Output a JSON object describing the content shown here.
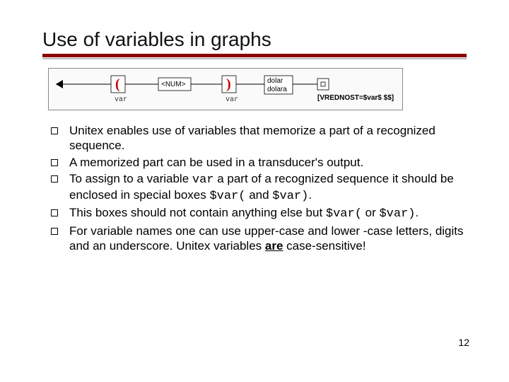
{
  "title": "Use of variables in graphs",
  "diagram": {
    "open_paren": "(",
    "num_label": "<NUM>",
    "close_paren": ")",
    "var_label_1": "var",
    "var_label_2": "var",
    "word1": "dolar",
    "word2": "dolara",
    "output": "[VREDNOST=$var$ $$]"
  },
  "bullets": [
    {
      "pre": "Unitex enables use of variables that memorize a part of a recognized sequence."
    },
    {
      "pre": "A memorized part can be used in a transducer's output."
    },
    {
      "pre": "To assign to a variable ",
      "code1": "var",
      "mid": " a part of a recognized sequence it should be enclosed in special boxes ",
      "code2": "$var(",
      "mid2": " and ",
      "code3": "$var)",
      "post": "."
    },
    {
      "pre": "This boxes should not contain anything else but ",
      "code2": "$var(",
      "mid2": " or ",
      "code3": "$var)",
      "post": "."
    },
    {
      "pre": "For variable names one can use upper-case and lower -case letters, digits and an underscore. Unitex variables ",
      "emph": "are",
      "post": " case-sensitive!"
    }
  ],
  "page_number": "12"
}
